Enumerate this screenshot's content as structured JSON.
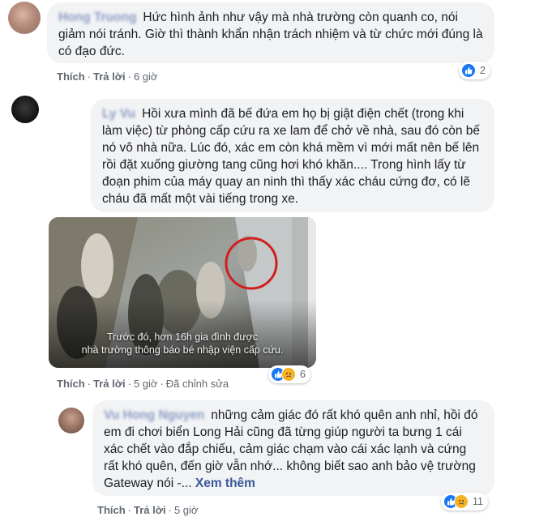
{
  "comments": [
    {
      "author": "Hong Truong",
      "text": "Hức hình ảnh như vậy mà nhà trường còn quanh co, nói giảm nói tránh. Giờ thì thành khẩn nhận trách nhiệm và từ chức mới đúng là có đạo đức.",
      "actions": {
        "like": "Thích",
        "reply": "Trả lời",
        "time": "6 giờ"
      },
      "reactions": {
        "count": "2",
        "icons": [
          "like-icon"
        ]
      }
    },
    {
      "author": "Ly Vu",
      "text": "Hồi xưa mình đã bế đứa em họ bị giật điện chết (trong khi làm việc) từ phòng cấp cứu ra xe lam để chở về nhà, sau đó còn bế nó vô nhà nữa. Lúc đó, xác em còn khá mềm vì mới mất nên bế lên rồi đặt xuống giường tang cũng hơi khó khăn.... Trong hình lấy từ đoạn phim của máy quay an ninh thì thấy xác cháu cứng đơ, có lẽ cháu đã mất một vài tiếng trong xe.",
      "image_caption": "Trước đó, hơn 16h gia đình được\nnhà trường thông báo bé nhập viện cấp cứu.",
      "actions": {
        "like": "Thích",
        "reply": "Trả lời",
        "time": "5 giờ",
        "edited": "Đã chỉnh sửa"
      },
      "reactions": {
        "count": "6",
        "icons": [
          "like-icon",
          "sad-icon"
        ]
      }
    },
    {
      "author": "Vu Hong Nguyen",
      "text": "những cảm giác đó rất khó quên anh nhỉ, hồi đó em đi chơi biển Long Hải cũng đã từng giúp người ta bưng 1 cái xác chết vào đắp chiếu, cảm giác chạm vào cái xác lạnh và cứng rất khó quên, đến giờ vẫn nhớ... không biết sao anh bảo vệ trường Gateway nói -...",
      "see_more": "Xem thêm",
      "actions": {
        "like": "Thích",
        "reply": "Trả lời",
        "time": "5 giờ"
      },
      "reactions": {
        "count": "11",
        "icons": [
          "like-icon",
          "sad-icon"
        ]
      }
    }
  ],
  "colors": {
    "bubble": "#f2f3f5",
    "like": "#1877f2",
    "sad": "#f7b125",
    "link": "#385898"
  }
}
